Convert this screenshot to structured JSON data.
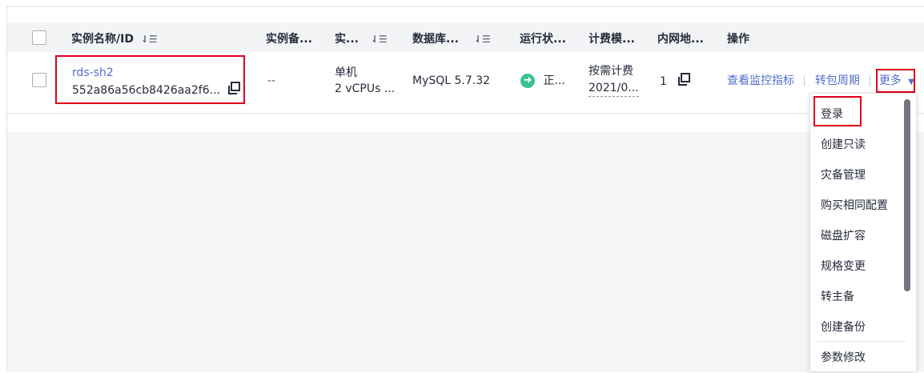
{
  "table": {
    "headers": {
      "name": "实例名称/ID",
      "remark": "实例备...",
      "type": "实...",
      "db": "数据库...",
      "status": "运行状...",
      "billing": "计费模...",
      "ip": "内网地...",
      "ops": "操作"
    },
    "sort_glyph": "⇃☰",
    "row": {
      "name": "rds-sh2",
      "id": "552a86a56cb8426aa2f6...",
      "remark": "--",
      "type_line1": "单机",
      "type_line2": "2 vCPUs ...",
      "db": "MySQL 5.7.32",
      "status": "正...",
      "billing_line1": "按需计费",
      "billing_line2": "2021/0...",
      "ip": "1",
      "op_monitor": "查看监控指标",
      "op_period": "转包周期",
      "op_more": "更多"
    }
  },
  "more_menu": {
    "items": [
      "登录",
      "创建只读",
      "灾备管理",
      "购买相同配置",
      "磁盘扩容",
      "规格变更",
      "转主备",
      "创建备份",
      "参数修改"
    ]
  },
  "colors": {
    "link": "#526ecc",
    "highlight": "#e0001a",
    "status_ok": "#3ac295"
  }
}
